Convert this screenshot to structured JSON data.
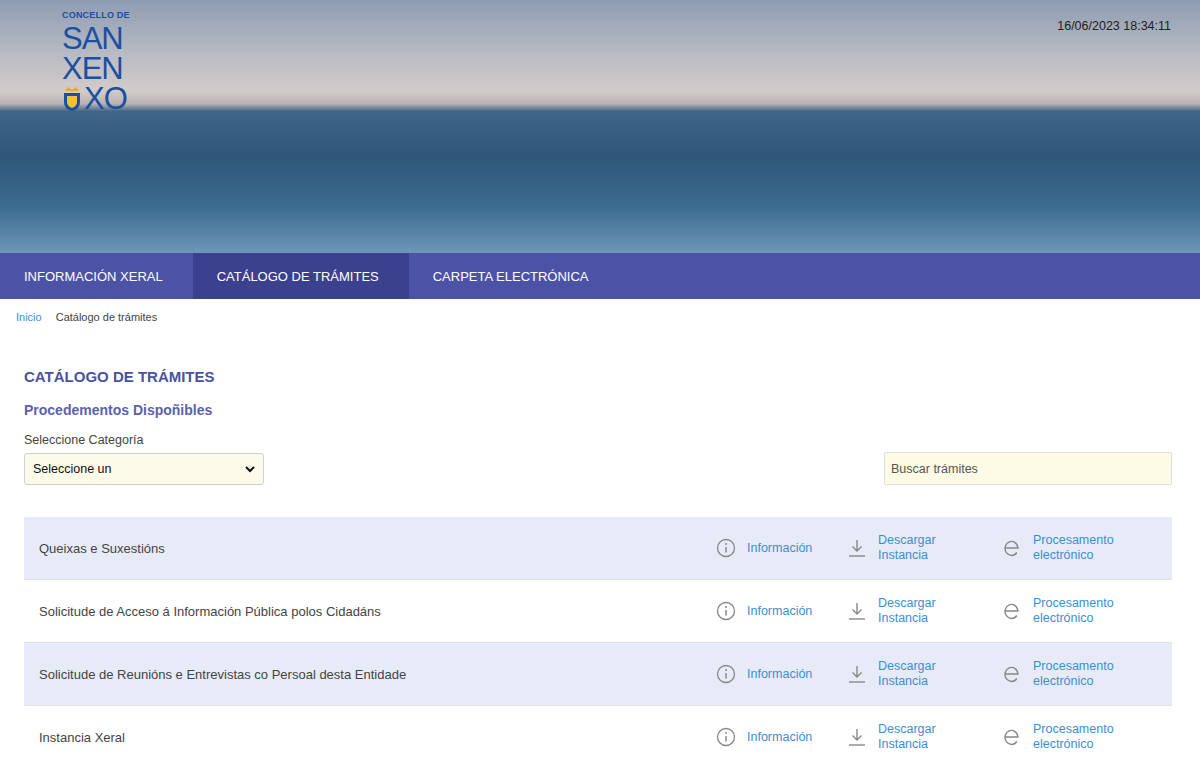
{
  "header": {
    "logo": {
      "top": "CONCELLO DE",
      "lines": [
        "SAN",
        "XEN",
        "XO"
      ]
    },
    "datetime": "16/06/2023 18:34:11"
  },
  "nav": [
    {
      "label": "INFORMACIÓN XERAL",
      "selected": false
    },
    {
      "label": "CATÁLOGO DE TRÁMITES",
      "selected": true
    },
    {
      "label": "CARPETA ELECTRÓNICA",
      "selected": false
    }
  ],
  "breadcrumb": [
    {
      "label": "Inicio",
      "link": true
    },
    {
      "label": "Catálogo de trámites",
      "link": false
    }
  ],
  "page": {
    "title": "CATÁLOGO DE TRÁMITES",
    "subtitle": "Procedementos Dispoñibles",
    "category_label": "Seleccione Categoría",
    "category_select": {
      "value": "Seleccione un"
    },
    "search": {
      "placeholder": "Buscar trámites"
    }
  },
  "procedures": [
    {
      "name": "Queixas e Suxestións",
      "actions": [
        {
          "label": "Información",
          "kind": "info"
        },
        {
          "label": "Descargar Instancia",
          "kind": "download"
        },
        {
          "label": "Procesamento electrónico",
          "kind": "electronic"
        }
      ]
    },
    {
      "name": "Solicitude de Acceso á Información Pública polos Cidadáns",
      "actions": [
        {
          "label": "Información",
          "kind": "info"
        },
        {
          "label": "Descargar Instancia",
          "kind": "download"
        },
        {
          "label": "Procesamento electrónico",
          "kind": "electronic"
        }
      ]
    },
    {
      "name": "Solicitude de Reunións e Entrevistas co Persoal desta Entidade",
      "actions": [
        {
          "label": "Información",
          "kind": "info"
        },
        {
          "label": "Descargar Instancia",
          "kind": "download"
        },
        {
          "label": "Procesamento electrónico",
          "kind": "electronic"
        }
      ]
    },
    {
      "name": "Instancia Xeral",
      "actions": [
        {
          "label": "Información",
          "kind": "info"
        },
        {
          "label": "Descargar Instancia",
          "kind": "download"
        },
        {
          "label": "Procesamento electrónico",
          "kind": "electronic"
        }
      ]
    }
  ]
}
